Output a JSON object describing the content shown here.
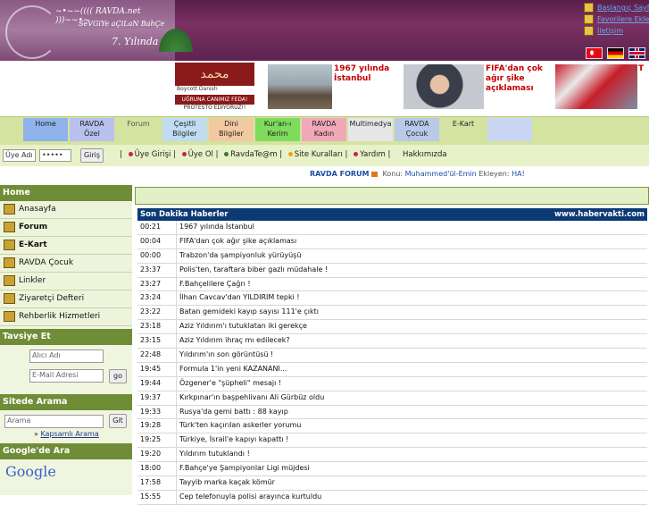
{
  "header": {
    "logo_line1": "~•~~(((( RAVDA.net )))~~•~",
    "logo_line2": "SeVGiYe aÇiLaN BahÇe",
    "logo_line3": "7. Yılında",
    "top_links": [
      "Başlangıç Sayfası",
      "Favorilere Ekle",
      "İletişim"
    ],
    "flags": [
      "tr",
      "de",
      "uk"
    ]
  },
  "banner": {
    "boycott_arabic": "محمد",
    "boycott_label": "Boycott Danish",
    "boycott_slogan": "UĞRUNA CANIMIZ FEDA!",
    "boycott_sub": "PROTESTO EDİYORUZ!!",
    "news1": "1967 yılında İstanbul",
    "news2": "FIFA'dan çok ağır şike açıklaması",
    "news3": "T"
  },
  "menu": [
    {
      "line1": "Home",
      "line2": "",
      "bg": "#8fb3ea"
    },
    {
      "line1": "RAVDA",
      "line2": "Özel",
      "bg": "#b8c1ee"
    },
    {
      "line1": "Forum",
      "line2": "",
      "bg": "#d4e3a0"
    },
    {
      "line1": "Çeşitli",
      "line2": "Bilgiler",
      "bg": "#bfdcf2"
    },
    {
      "line1": "Dini",
      "line2": "Bilgiler",
      "bg": "#f3c9a2"
    },
    {
      "line1": "Kur'an-ı",
      "line2": "Kerim",
      "bg": "#7fdb5d"
    },
    {
      "line1": "RAVDA",
      "line2": "Kadın",
      "bg": "#f1a8b9"
    },
    {
      "line1": "Multimedya",
      "line2": "",
      "bg": "#e6e6e6"
    },
    {
      "line1": "RAVDA",
      "line2": "Çocuk",
      "bg": "#b9c9e8"
    },
    {
      "line1": "E-Kart",
      "line2": "",
      "bg": "#d4e3a0"
    },
    {
      "line1": "",
      "line2": "",
      "bg": "#c9d6f3"
    }
  ],
  "login": {
    "username_value": "Üye Adı",
    "password_value": "•••••",
    "submit_label": "Giriş",
    "links": [
      {
        "label": "Üye Girişi",
        "color": "#c4225d"
      },
      {
        "label": "Üye Ol",
        "color": "#c4225d"
      },
      {
        "label": "RavdaTe@m",
        "color": "#3b7a2b"
      },
      {
        "label": "Site Kuralları",
        "color": "#e8a516"
      },
      {
        "label": "Yardım",
        "color": "#c4225d"
      },
      {
        "label": "Hakkımızda",
        "color": "#e8e8e8"
      }
    ]
  },
  "forum": {
    "title": "RAVDA FORUM",
    "topic_label": "Konu:",
    "topic_value": "Muhammed'ül-Emin",
    "added_label": "Ekleyen:",
    "added_value": "HA!"
  },
  "sidebar": {
    "home_header": "Home",
    "items": [
      {
        "label": "Anasayfa",
        "bold": false
      },
      {
        "label": "Forum",
        "bold": true
      },
      {
        "label": "E-Kart",
        "bold": true
      },
      {
        "label": "RAVDA Çocuk",
        "bold": false
      },
      {
        "label": "Linkler",
        "bold": false
      },
      {
        "label": "Ziyaretçi Defteri",
        "bold": false
      },
      {
        "label": "Rehberlik Hizmetleri",
        "bold": false
      }
    ],
    "recommend_header": "Tavsiye Et",
    "recommend_name_placeholder": "Alıcı Adı",
    "recommend_email_placeholder": "E-Mail Adresi",
    "recommend_button": "go",
    "search_header": "Sitede Arama",
    "search_placeholder": "Arama",
    "search_button": "Git",
    "advanced_search": "Kapsamlı Arama",
    "google_header": "Google'de Ara",
    "google_logo": "Google"
  },
  "news": {
    "header_left": "Son Dakika Haberler",
    "header_right": "www.habervakti.com",
    "rows": [
      {
        "time": "00:21",
        "headline": "1967 yılında İstanbul"
      },
      {
        "time": "00:04",
        "headline": "FIFA'dan çok ağır şike açıklaması"
      },
      {
        "time": "00:00",
        "headline": "Trabzon'da şampiyonluk yürüyüşü"
      },
      {
        "time": "23:37",
        "headline": "Polis'ten, taraftara biber gazlı müdahale !"
      },
      {
        "time": "23:27",
        "headline": "F.Bahçelilere Çağrı !"
      },
      {
        "time": "23:24",
        "headline": "İlhan Cavcav'dan YILDIRIM tepki !"
      },
      {
        "time": "23:22",
        "headline": "Batan gemideki kayıp sayısı 111'e çıktı"
      },
      {
        "time": "23:18",
        "headline": "Aziz Yıldırım'ı tutuklatan iki gerekçe"
      },
      {
        "time": "23:15",
        "headline": "Aziz Yıldırım ihraç mı edilecek?"
      },
      {
        "time": "22:48",
        "headline": "Yıldırım'ın son görüntüsü !"
      },
      {
        "time": "19:45",
        "headline": "Formula 1'in yeni KAZANANI..."
      },
      {
        "time": "19:44",
        "headline": "Özgener'e \"şüpheli\" mesajı !"
      },
      {
        "time": "19:37",
        "headline": "Kırkpınar'ın başpehlivanı Ali Gürbüz oldu"
      },
      {
        "time": "19:33",
        "headline": "Rusya'da gemi battı : 88 kayıp"
      },
      {
        "time": "19:28",
        "headline": "Türk'ten kaçırılan askerler yorumu"
      },
      {
        "time": "19:25",
        "headline": "Türkiye, İsrail'e kapıyı kapattı !"
      },
      {
        "time": "19:20",
        "headline": "Yıldırım tutuklandı !"
      },
      {
        "time": "18:00",
        "headline": "F.Bahçe'ye Şampiyonlar Ligi müjdesi"
      },
      {
        "time": "17:58",
        "headline": "Tayyib marka kaçak kömür"
      },
      {
        "time": "15:55",
        "headline": "Cep telefonuyla polisi arayınca kurtuldu"
      }
    ]
  }
}
